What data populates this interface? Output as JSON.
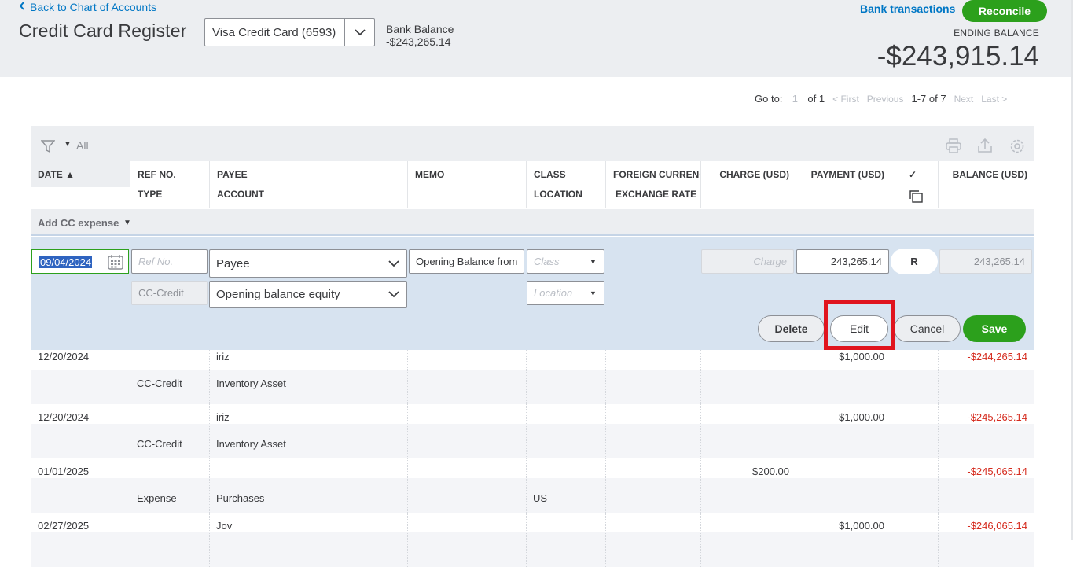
{
  "header": {
    "back_link": "Back to Chart of Accounts",
    "title": "Credit Card Register",
    "account_selected": "Visa Credit Card (6593)",
    "bank_balance_label": "Bank Balance",
    "bank_balance_value": "-$243,265.14",
    "bank_transactions": "Bank transactions",
    "reconcile": "Reconcile",
    "ending_balance_label": "ENDING BALANCE",
    "ending_balance_value": "-$243,915.14"
  },
  "pager": {
    "goto": "Go to:",
    "page": "1",
    "of": "of 1",
    "first": "< First",
    "previous": "Previous",
    "range": "1-7 of 7",
    "next": "Next",
    "last": "Last >"
  },
  "toolbar": {
    "filter_label": "All",
    "icons": [
      "filter-icon",
      "print-icon",
      "export-icon",
      "settings-icon"
    ]
  },
  "columns": {
    "date": "DATE ▲",
    "ref_no": "REF NO.",
    "type": "TYPE",
    "payee": "PAYEE",
    "account": "ACCOUNT",
    "memo": "MEMO",
    "class": "CLASS",
    "location": "LOCATION",
    "foreign_currency": "FOREIGN CURRENC",
    "exchange_rate": "EXCHANGE RATE",
    "charge": "CHARGE (USD)",
    "payment": "PAYMENT (USD)",
    "check": "✓",
    "balance": "BALANCE (USD)"
  },
  "add_bar": {
    "label": "Add CC expense"
  },
  "edit_row": {
    "date": "09/04/2024",
    "ref_placeholder": "Ref No.",
    "type": "CC-Credit",
    "payee": "Payee",
    "account": "Opening balance equity",
    "memo": "Opening Balance from",
    "class_placeholder": "Class",
    "location_placeholder": "Location",
    "charge_placeholder": "Charge",
    "payment": "243,265.14",
    "reconcile_status": "R",
    "balance": "243,265.14",
    "buttons": {
      "delete": "Delete",
      "edit": "Edit",
      "cancel": "Cancel",
      "save": "Save"
    }
  },
  "rows": [
    {
      "date": "12/20/2024",
      "type": "CC-Credit",
      "payee": "iriz",
      "account": "Inventory Asset",
      "class": "",
      "location": "",
      "charge": "",
      "payment": "$1,000.00",
      "balance": "-$244,265.14"
    },
    {
      "date": "12/20/2024",
      "type": "CC-Credit",
      "payee": "iriz",
      "account": "Inventory Asset",
      "class": "",
      "location": "",
      "charge": "",
      "payment": "$1,000.00",
      "balance": "-$245,265.14"
    },
    {
      "date": "01/01/2025",
      "type": "Expense",
      "payee": "",
      "account": "Purchases",
      "class": "",
      "location": "US",
      "charge": "$200.00",
      "payment": "",
      "balance": "-$245,065.14"
    },
    {
      "date": "02/27/2025",
      "type": "",
      "payee": "Jov",
      "account": "",
      "class": "",
      "location": "",
      "charge": "",
      "payment": "$1,000.00",
      "balance": "-$246,065.14"
    }
  ],
  "colors": {
    "accent_green": "#2ca01c",
    "link_blue": "#0077c5",
    "negative_red": "#d52b1e",
    "highlight_red": "#e0141e"
  }
}
